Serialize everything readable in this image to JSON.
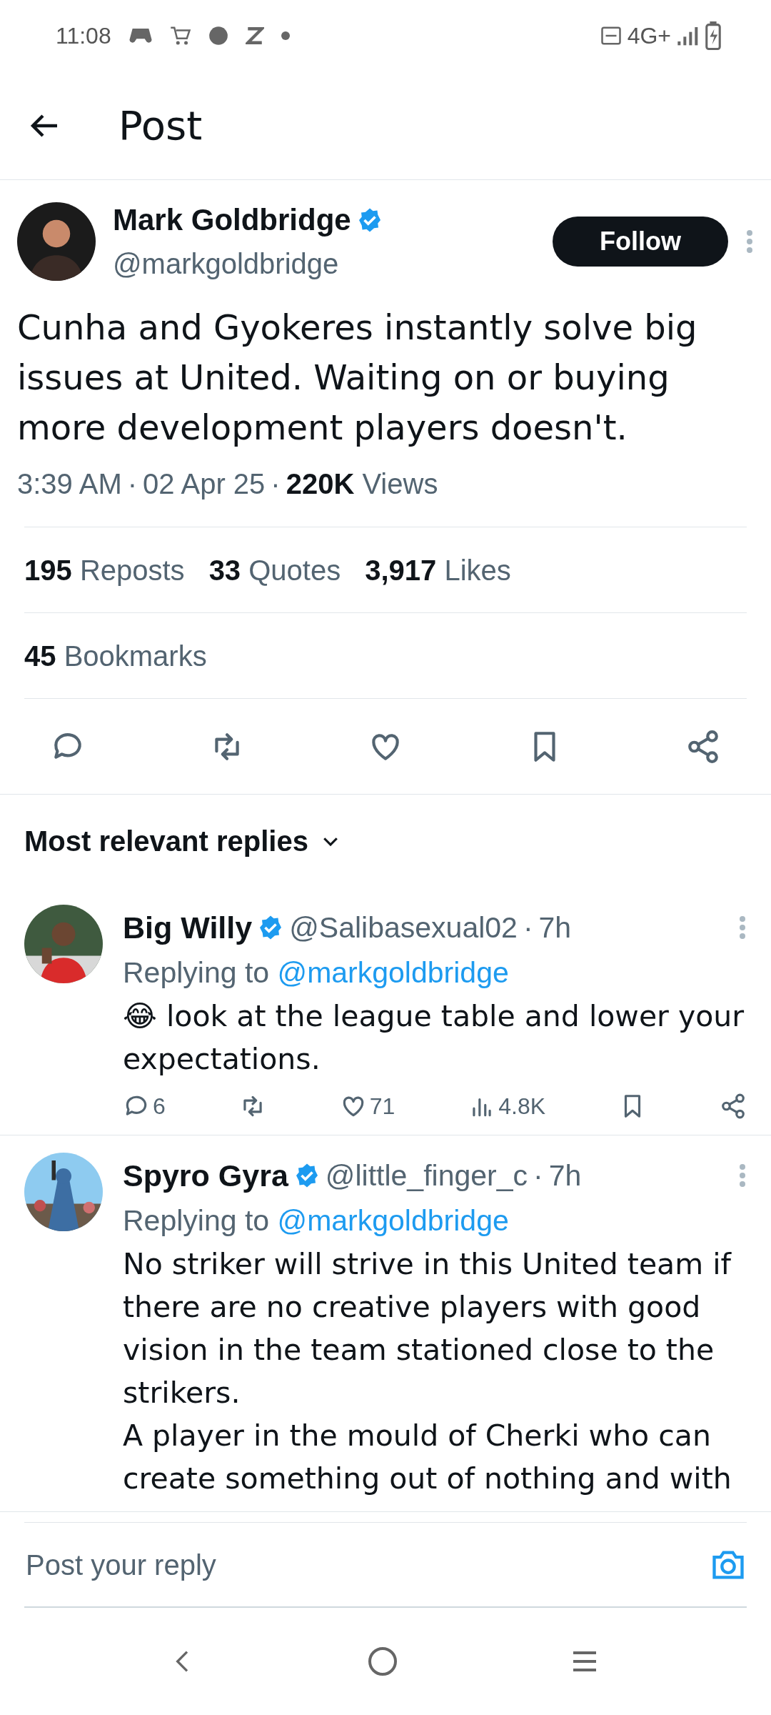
{
  "status_bar": {
    "time": "11:08",
    "network": "4G+"
  },
  "header": {
    "title": "Post"
  },
  "post": {
    "author": {
      "name": "Mark Goldbridge",
      "handle": "@markgoldbridge",
      "verified": true
    },
    "follow_label": "Follow",
    "text": "Cunha and Gyokeres instantly solve big issues at United. Waiting on or buying more development players doesn't.",
    "time": "3:39 AM",
    "separator": "·",
    "date": "02 Apr 25",
    "views_count": "220K",
    "views_label": "Views"
  },
  "stats": [
    {
      "count": "195",
      "label": "Reposts"
    },
    {
      "count": "33",
      "label": "Quotes"
    },
    {
      "count": "3,917",
      "label": "Likes"
    }
  ],
  "bookmarks": {
    "count": "45",
    "label": "Bookmarks"
  },
  "actions": [
    {
      "kind": "reply"
    },
    {
      "kind": "repost"
    },
    {
      "kind": "like"
    },
    {
      "kind": "bookmark"
    },
    {
      "kind": "share"
    }
  ],
  "replies_filter": {
    "label": "Most relevant replies"
  },
  "replies": [
    {
      "name": "Big Willy",
      "verified": true,
      "handle": "@Salibasexual02",
      "separator": "·",
      "time": "7h",
      "replying_prefix": "Replying to",
      "replying_handle": "@markgoldbridge",
      "paragraphs": [
        "😂 look at the league table and lower your expectations."
      ],
      "metrics": [
        {
          "kind": "reply",
          "count": "6"
        },
        {
          "kind": "repost"
        },
        {
          "kind": "like",
          "count": "71"
        },
        {
          "kind": "views",
          "count": "4.8K"
        },
        {
          "kind": "bookmark"
        },
        {
          "kind": "share"
        }
      ]
    },
    {
      "name": "Spyro Gyra",
      "verified": true,
      "handle": "@little_finger_c",
      "separator": "·",
      "time": "7h",
      "replying_prefix": "Replying to",
      "replying_handle": "@markgoldbridge",
      "paragraphs": [
        "No striker will strive in this United team if there are no creative players with good vision in the team stationed close to the strikers.",
        "A player in the mould of Cherki who can create something out of nothing and with"
      ]
    }
  ],
  "composer": {
    "placeholder": "Post your reply"
  }
}
